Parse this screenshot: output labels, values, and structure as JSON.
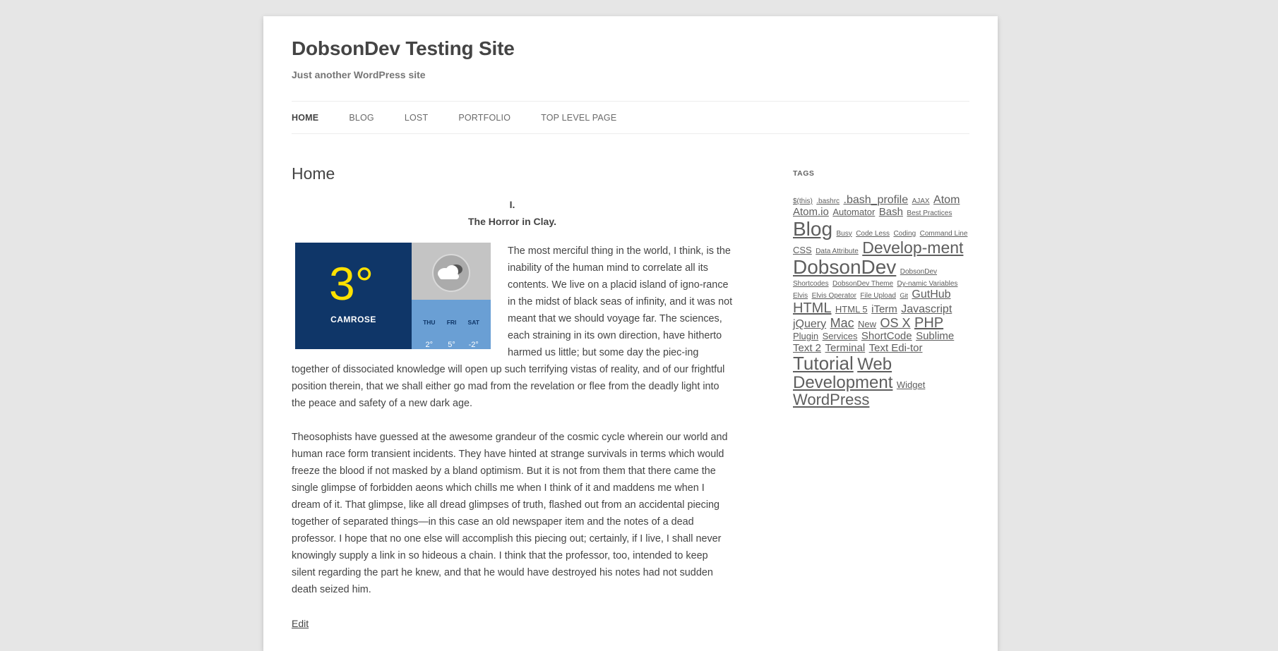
{
  "site": {
    "title": "DobsonDev Testing Site",
    "description": "Just another WordPress site"
  },
  "nav": {
    "items": [
      {
        "label": "HOME",
        "current": true
      },
      {
        "label": "BLOG"
      },
      {
        "label": "LOST"
      },
      {
        "label": "PORTFOLIO"
      },
      {
        "label": "TOP LEVEL PAGE"
      }
    ]
  },
  "main": {
    "title": "Home",
    "heading_line1": "I.",
    "heading_line2": "The Horror in Clay.",
    "paragraphs": [
      "The most merciful thing in the world, I think, is the inability of the human mind to correlate all its contents. We live on a placid island of igno-rance in the midst of black seas of infinity, and it was not meant that we should voyage far. The sciences, each straining in its own direction, have hitherto harmed us little; but some day the piec-ing together of dissociated knowledge will open up such terrifying vistas of reality, and of our frightful position therein, that we shall either go mad from the revelation or flee from the deadly light into the peace and safety of a new dark age.",
      "Theosophists have guessed at the awesome grandeur of the cosmic cycle wherein our world and human race form transient incidents. They have hinted at strange survivals in terms which would freeze the blood if not masked by a bland optimism. But it is not from them that there came the single glimpse of forbidden aeons which chills me when I think of it and maddens me when I dream of it. That glimpse, like all dread glimpses of truth, flashed out from an accidental piecing together of separated things—in this case an old newspaper item and the notes of a dead professor. I hope that no one else will accomplish this piecing out; certainly, if I live, I shall never knowingly supply a link in so hideous a chain. I think that the professor, too, intended to keep silent regarding the part he knew, and that he would have destroyed his notes had not sudden death seized him."
    ],
    "edit_label": "Edit"
  },
  "weather": {
    "temp": "3°",
    "city": "CAMROSE",
    "current_icon": "cloud-icon",
    "colors": {
      "panel": "#0f3668",
      "temp": "#ffe100",
      "now_bg": "#c4c4c4",
      "forecast_bg": "#6a9fd4"
    },
    "forecast": [
      {
        "day": "THU",
        "temp": "2°"
      },
      {
        "day": "FRI",
        "temp": "5°"
      },
      {
        "day": "SAT",
        "temp": "-2°"
      }
    ]
  },
  "sidebar": {
    "widget_title": "TAGS",
    "tags": [
      {
        "label": "$(this)",
        "size": 10
      },
      {
        "label": ".bashrc",
        "size": 10
      },
      {
        "label": ".bash_profile",
        "size": 16
      },
      {
        "label": "AJAX",
        "size": 10
      },
      {
        "label": "Atom",
        "size": 16
      },
      {
        "label": "Atom.io",
        "size": 15
      },
      {
        "label": "Automator",
        "size": 13
      },
      {
        "label": "Bash",
        "size": 15
      },
      {
        "label": "Best Practices",
        "size": 10
      },
      {
        "label": "Blog",
        "size": 28
      },
      {
        "label": "Busy",
        "size": 10
      },
      {
        "label": "Code Less",
        "size": 10
      },
      {
        "label": "Coding",
        "size": 10
      },
      {
        "label": "Command Line",
        "size": 10
      },
      {
        "label": "CSS",
        "size": 13
      },
      {
        "label": "Data Attribute",
        "size": 10
      },
      {
        "label": "Develop-ment",
        "size": 23
      },
      {
        "label": "DobsonDev",
        "size": 28
      },
      {
        "label": "DobsonDev Shortcodes",
        "size": 10
      },
      {
        "label": "DobsonDev Theme",
        "size": 10
      },
      {
        "label": "Dy-namic Variables",
        "size": 10
      },
      {
        "label": "Elvis",
        "size": 10
      },
      {
        "label": "Elvis Operator",
        "size": 10
      },
      {
        "label": "File Upload",
        "size": 10
      },
      {
        "label": "Git",
        "size": 9
      },
      {
        "label": "GutHub",
        "size": 16
      },
      {
        "label": "HTML",
        "size": 20
      },
      {
        "label": "HTML 5",
        "size": 13
      },
      {
        "label": "iTerm",
        "size": 15
      },
      {
        "label": "Javascript",
        "size": 16
      },
      {
        "label": "jQuery",
        "size": 16
      },
      {
        "label": "Mac",
        "size": 18
      },
      {
        "label": "New",
        "size": 13
      },
      {
        "label": "OS X",
        "size": 18
      },
      {
        "label": "PHP",
        "size": 20
      },
      {
        "label": "Plugin",
        "size": 13
      },
      {
        "label": "Services",
        "size": 13
      },
      {
        "label": "ShortCode",
        "size": 15
      },
      {
        "label": "Sublime Text 2",
        "size": 15
      },
      {
        "label": "Terminal",
        "size": 15
      },
      {
        "label": "Text Edi-tor",
        "size": 15
      },
      {
        "label": "Tutorial",
        "size": 26
      },
      {
        "label": "Web Development",
        "size": 24
      },
      {
        "label": "Widget",
        "size": 13
      },
      {
        "label": "WordPress",
        "size": 22
      }
    ]
  }
}
